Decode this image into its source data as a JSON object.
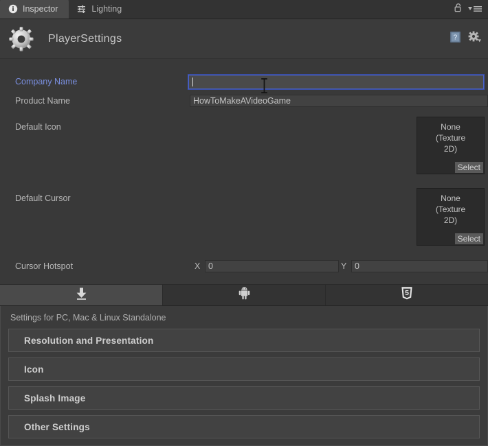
{
  "window": {
    "tabs": [
      {
        "label": "Inspector",
        "icon": "info-circle-icon",
        "active": true
      },
      {
        "label": "Lighting",
        "icon": "sliders-icon",
        "active": false
      }
    ],
    "lock_icon": "lock-open-icon",
    "menu_icon": "hamburger-menu-icon"
  },
  "object_header": {
    "icon": "gear-icon",
    "title": "PlayerSettings",
    "help_icon": "help-book-icon",
    "settings_icon": "gear-dropdown-icon"
  },
  "properties": {
    "company_name": {
      "label": "Company Name",
      "value": "",
      "focused": true
    },
    "product_name": {
      "label": "Product Name",
      "value": "HowToMakeAVideoGame"
    },
    "default_icon": {
      "label": "Default Icon",
      "value": "None\n(Texture\n2D)",
      "value_line1": "None",
      "value_line2": "(Texture",
      "value_line3": "2D)",
      "select_label": "Select"
    },
    "default_cursor": {
      "label": "Default Cursor",
      "value_line1": "None",
      "value_line2": "(Texture",
      "value_line3": "2D)",
      "select_label": "Select"
    },
    "cursor_hotspot": {
      "label": "Cursor Hotspot",
      "x_axis": "X",
      "x_value": "0",
      "y_axis": "Y",
      "y_value": "0"
    }
  },
  "platform_tabs": [
    {
      "name": "standalone",
      "icon": "download-arrow-icon",
      "active": true
    },
    {
      "name": "android",
      "icon": "android-robot-icon",
      "active": false
    },
    {
      "name": "webgl",
      "icon": "html5-shield-icon",
      "active": false
    }
  ],
  "settings_panel": {
    "caption": "Settings for PC, Mac & Linux Standalone",
    "sections": [
      {
        "label": "Resolution and Presentation"
      },
      {
        "label": "Icon"
      },
      {
        "label": "Splash Image"
      },
      {
        "label": "Other Settings"
      }
    ]
  },
  "colors": {
    "background": "#393939",
    "panel": "#3b3b3b",
    "tabbar": "#333333",
    "focus_blue": "#4a62c8",
    "label_text": "#b8b8b8",
    "focused_label": "#7a8fe0"
  }
}
